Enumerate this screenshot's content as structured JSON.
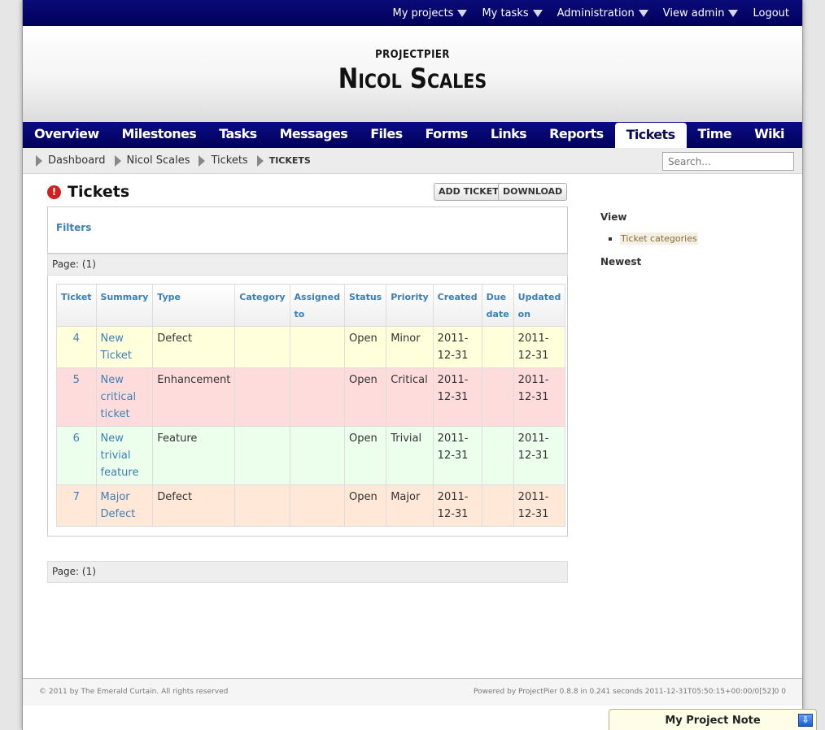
{
  "userbar": {
    "items": [
      {
        "label": "My projects",
        "dropdown": true
      },
      {
        "label": "My tasks",
        "dropdown": true
      },
      {
        "label": "Administration",
        "dropdown": true
      },
      {
        "label": "View admin",
        "dropdown": true
      },
      {
        "label": "Logout",
        "dropdown": false
      }
    ]
  },
  "header": {
    "site_name": "PROJECTPIER",
    "project_name": "Nicol Scales"
  },
  "tabs": [
    {
      "label": "Overview"
    },
    {
      "label": "Milestones"
    },
    {
      "label": "Tasks"
    },
    {
      "label": "Messages"
    },
    {
      "label": "Files"
    },
    {
      "label": "Forms"
    },
    {
      "label": "Links"
    },
    {
      "label": "Reports"
    },
    {
      "label": "Tickets",
      "active": true
    },
    {
      "label": "Time"
    },
    {
      "label": "Wiki"
    }
  ],
  "breadcrumb": [
    "Dashboard",
    "Nicol Scales",
    "Tickets",
    "TICKETS"
  ],
  "search": {
    "placeholder": "Search..."
  },
  "main": {
    "title": "Tickets",
    "add_ticket": "ADD TICKET",
    "download": "DOWNLOAD",
    "filters": "Filters",
    "page_label_top": "Page: (1)",
    "page_label_bottom": "Page: (1)"
  },
  "table": {
    "headers": [
      "Ticket",
      "Summary",
      "Type",
      "Category",
      "Assigned to",
      "Status",
      "Priority",
      "Created",
      "Due date",
      "Updated on"
    ],
    "rows": [
      {
        "ticket": "4",
        "summary": "New Ticket",
        "type": "Defect",
        "category": "",
        "assigned": "",
        "status": "Open",
        "priority": "Minor",
        "created": "2011-12-31",
        "due": "",
        "updated": "2011-12-31",
        "color": "#ffffdc"
      },
      {
        "ticket": "5",
        "summary": "New critical ticket",
        "type": "Enhancement",
        "category": "",
        "assigned": "",
        "status": "Open",
        "priority": "Critical",
        "created": "2011-12-31",
        "due": "",
        "updated": "2011-12-31",
        "color": "#ffdcdc"
      },
      {
        "ticket": "6",
        "summary": "New trivial feature",
        "type": "Feature",
        "category": "",
        "assigned": "",
        "status": "Open",
        "priority": "Trivial",
        "created": "2011-12-31",
        "due": "",
        "updated": "2011-12-31",
        "color": "#ecffec"
      },
      {
        "ticket": "7",
        "summary": "Major Defect",
        "type": "Defect",
        "category": "",
        "assigned": "",
        "status": "Open",
        "priority": "Major",
        "created": "2011-12-31",
        "due": "",
        "updated": "2011-12-31",
        "color": "#ffe8d8"
      }
    ]
  },
  "sidebar": {
    "view_heading": "View",
    "view_items": [
      "Ticket categories"
    ],
    "newest_heading": "Newest"
  },
  "footer": {
    "copyright": "© 2011 by The Emerald Curtain. All rights reserved",
    "powered": "Powered by ProjectPier 0.8.8 in 0.241 seconds 2011-12-31T05:50:15+00:00/0[52]0 0"
  },
  "note": {
    "title": "My Project Note"
  },
  "colors": {
    "navy": "#00005a",
    "link": "#3b7fb5"
  },
  "icons": {
    "alert": "alert-icon",
    "dropdown": "triangle-down-icon",
    "breadcrumb": "arrow-right-icon",
    "note_toggle": "arrow-down-icon"
  }
}
